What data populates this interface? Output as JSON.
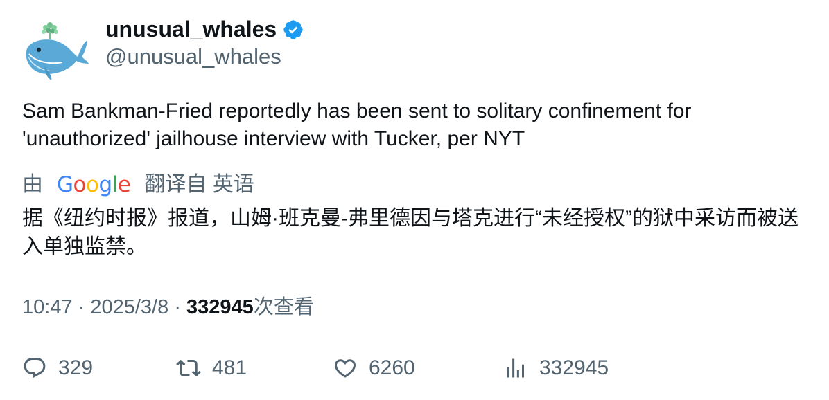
{
  "author": {
    "display_name": "unusual_whales",
    "handle": "@unusual_whales",
    "verified": true,
    "avatar_icon": "whale-logo-icon"
  },
  "tweet": {
    "text": "Sam Bankman-Fried reportedly has been sent to solitary confinement for 'unauthorized' jailhouse interview with Tucker, per NYT",
    "translation": {
      "prefix": "由",
      "provider": "Google",
      "suffix": "翻译自 英语",
      "text": "据《纽约时报》报道，山姆·班克曼-弗里德因与塔克进行“未经授权”的狱中采访而被送入单独监禁。"
    },
    "time": "10:47",
    "separator": "·",
    "date": "2025/3/8",
    "views_count": "332945",
    "views_suffix": "次查看"
  },
  "actions": {
    "replies": "329",
    "retweets": "481",
    "likes": "6260",
    "views": "332945"
  },
  "colors": {
    "verified_badge": "#1d9bf0",
    "secondary_text": "#536471",
    "primary_text": "#0f1419"
  }
}
